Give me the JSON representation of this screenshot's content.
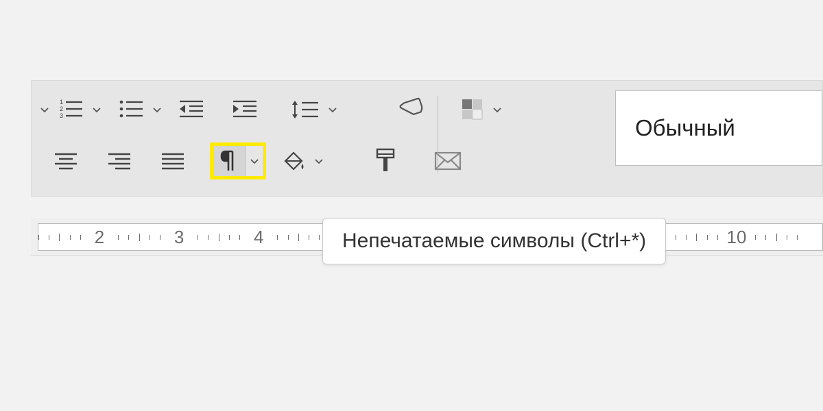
{
  "toolbar": {
    "row1": {
      "numbered_list": "numbered-list",
      "bulleted_list": "bulleted-list",
      "decrease_indent": "decrease-indent",
      "increase_indent": "increase-indent",
      "line_spacing": "line-spacing",
      "eraser": "eraser",
      "color_grid": "color-grid"
    },
    "row2": {
      "align_center": "align-center",
      "align_right": "align-right",
      "align_justify": "align-justify",
      "pilcrow": "pilcrow",
      "fill_color": "fill-color",
      "format_paint": "format-paint",
      "envelope": "envelope"
    }
  },
  "style_box_label": "Обычный",
  "tooltip_text": "Непечатаемые символы (Ctrl+*)",
  "ruler_numbers": [
    2,
    3,
    4,
    10
  ]
}
